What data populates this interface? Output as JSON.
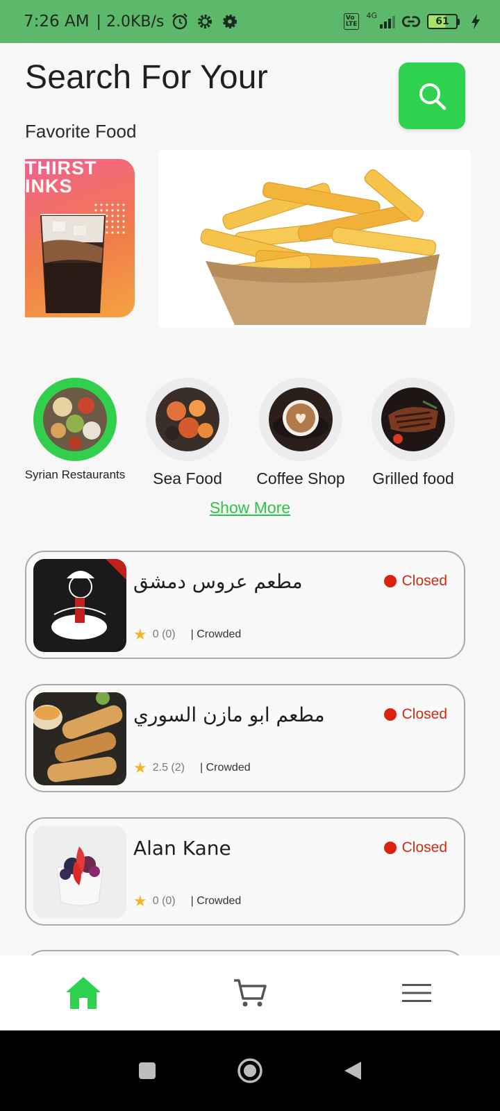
{
  "status_bar": {
    "time": "7:26 AM",
    "speed": "| 2.0KB/s",
    "network": "4G",
    "battery": "61",
    "icons": [
      "alarm-icon",
      "settings-gear-icon",
      "settings-icon",
      "volte-icon",
      "signal-icon",
      "link-icon",
      "battery-icon",
      "charging-icon"
    ]
  },
  "header": {
    "title": "Search For Your",
    "subtitle": "Favorite Food"
  },
  "banner": {
    "left_promo_text": "HIRST\nINKS"
  },
  "categories": [
    {
      "label": "Syrian Restaurants",
      "selected": true
    },
    {
      "label": "Sea Food",
      "selected": false
    },
    {
      "label": "Coffee Shop",
      "selected": false
    },
    {
      "label": "Grilled food",
      "selected": false
    }
  ],
  "show_more": "Show More",
  "restaurants": [
    {
      "name": "مطعم عروس دمشق",
      "status": "Closed",
      "rating": "0 (0)",
      "crowd": "| Crowded"
    },
    {
      "name": "مطعم ابو مازن السوري",
      "status": "Closed",
      "rating": "2.5 (2)",
      "crowd": "| Crowded"
    },
    {
      "name": "Alan Kane",
      "status": "Closed",
      "rating": "0 (0)",
      "crowd": "| Crowded"
    }
  ],
  "colors": {
    "accent": "#2fd24f",
    "status_bar": "#5cb86a",
    "closed": "#d92310",
    "star": "#f5b52a"
  },
  "bottom_nav": [
    "home-icon",
    "cart-icon",
    "menu-icon"
  ],
  "system_nav": [
    "recents-square-icon",
    "home-circle-icon",
    "back-triangle-icon"
  ]
}
